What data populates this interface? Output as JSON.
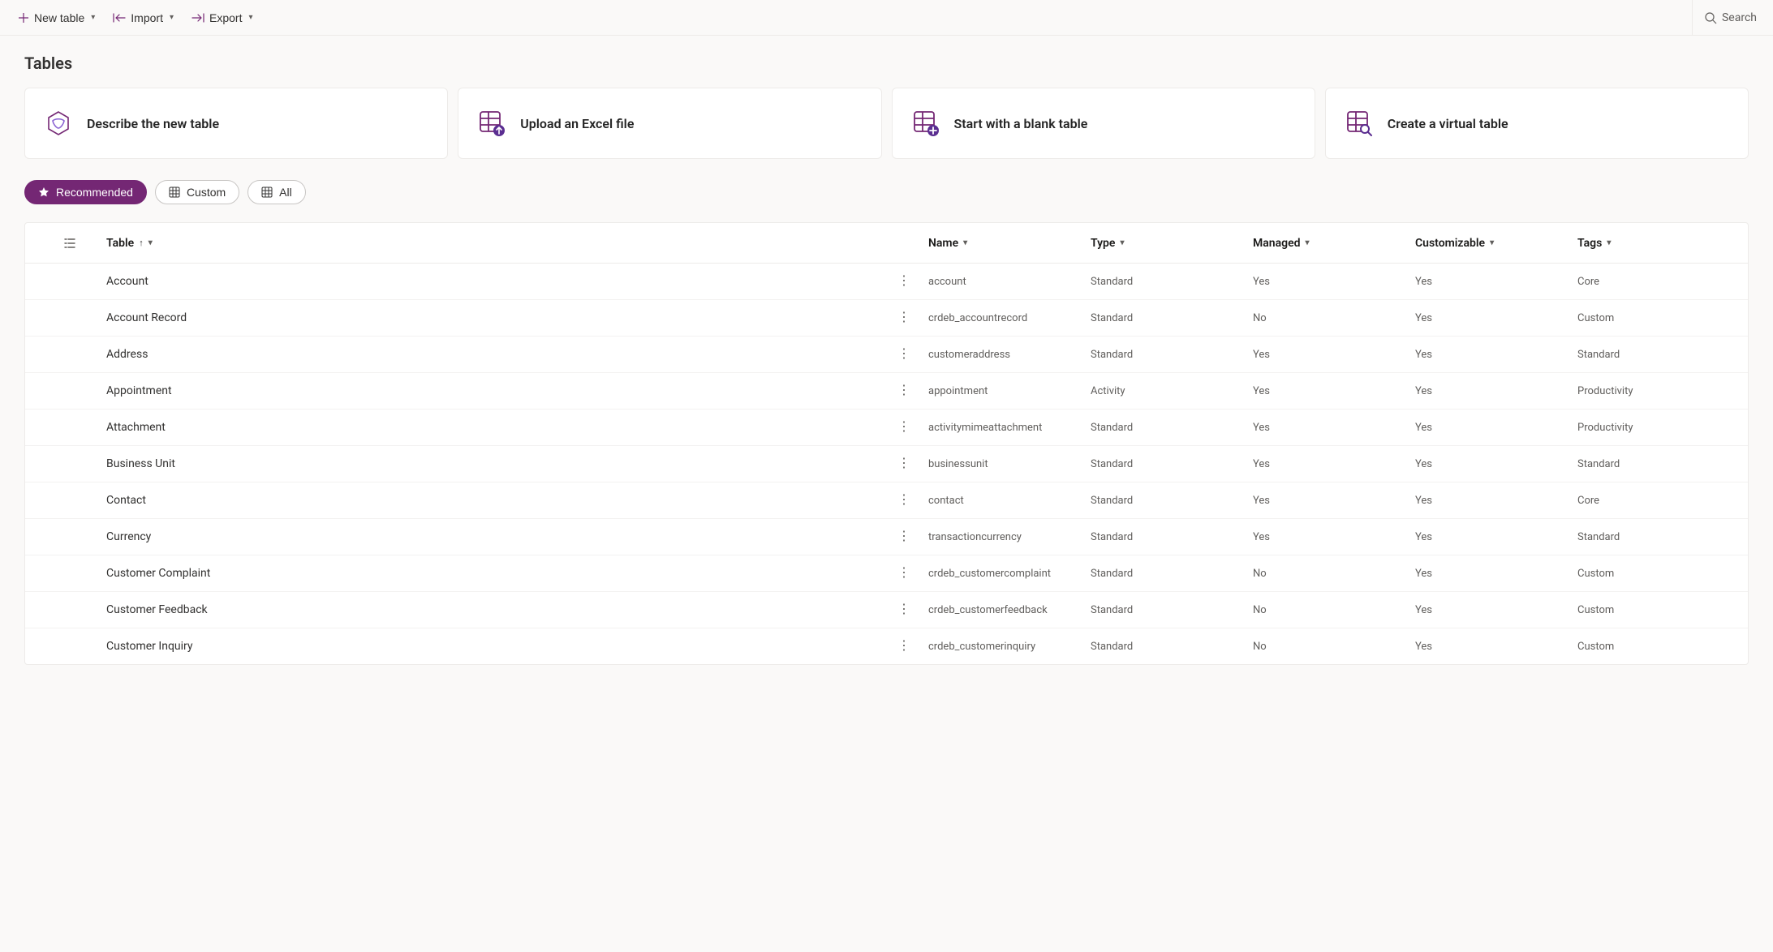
{
  "commandBar": {
    "newTable": "New table",
    "import": "Import",
    "export": "Export",
    "search": "Search"
  },
  "pageTitle": "Tables",
  "cards": [
    {
      "label": "Describe the new table"
    },
    {
      "label": "Upload an Excel file"
    },
    {
      "label": "Start with a blank table"
    },
    {
      "label": "Create a virtual table"
    }
  ],
  "filters": {
    "recommended": "Recommended",
    "custom": "Custom",
    "all": "All"
  },
  "columns": {
    "table": "Table",
    "name": "Name",
    "type": "Type",
    "managed": "Managed",
    "customizable": "Customizable",
    "tags": "Tags"
  },
  "rows": [
    {
      "display": "Account",
      "name": "account",
      "type": "Standard",
      "managed": "Yes",
      "customizable": "Yes",
      "tags": "Core"
    },
    {
      "display": "Account Record",
      "name": "crdeb_accountrecord",
      "type": "Standard",
      "managed": "No",
      "customizable": "Yes",
      "tags": "Custom"
    },
    {
      "display": "Address",
      "name": "customeraddress",
      "type": "Standard",
      "managed": "Yes",
      "customizable": "Yes",
      "tags": "Standard"
    },
    {
      "display": "Appointment",
      "name": "appointment",
      "type": "Activity",
      "managed": "Yes",
      "customizable": "Yes",
      "tags": "Productivity"
    },
    {
      "display": "Attachment",
      "name": "activitymimeattachment",
      "type": "Standard",
      "managed": "Yes",
      "customizable": "Yes",
      "tags": "Productivity"
    },
    {
      "display": "Business Unit",
      "name": "businessunit",
      "type": "Standard",
      "managed": "Yes",
      "customizable": "Yes",
      "tags": "Standard"
    },
    {
      "display": "Contact",
      "name": "contact",
      "type": "Standard",
      "managed": "Yes",
      "customizable": "Yes",
      "tags": "Core"
    },
    {
      "display": "Currency",
      "name": "transactioncurrency",
      "type": "Standard",
      "managed": "Yes",
      "customizable": "Yes",
      "tags": "Standard"
    },
    {
      "display": "Customer Complaint",
      "name": "crdeb_customercomplaint",
      "type": "Standard",
      "managed": "No",
      "customizable": "Yes",
      "tags": "Custom"
    },
    {
      "display": "Customer Feedback",
      "name": "crdeb_customerfeedback",
      "type": "Standard",
      "managed": "No",
      "customizable": "Yes",
      "tags": "Custom"
    },
    {
      "display": "Customer Inquiry",
      "name": "crdeb_customerinquiry",
      "type": "Standard",
      "managed": "No",
      "customizable": "Yes",
      "tags": "Custom"
    }
  ]
}
